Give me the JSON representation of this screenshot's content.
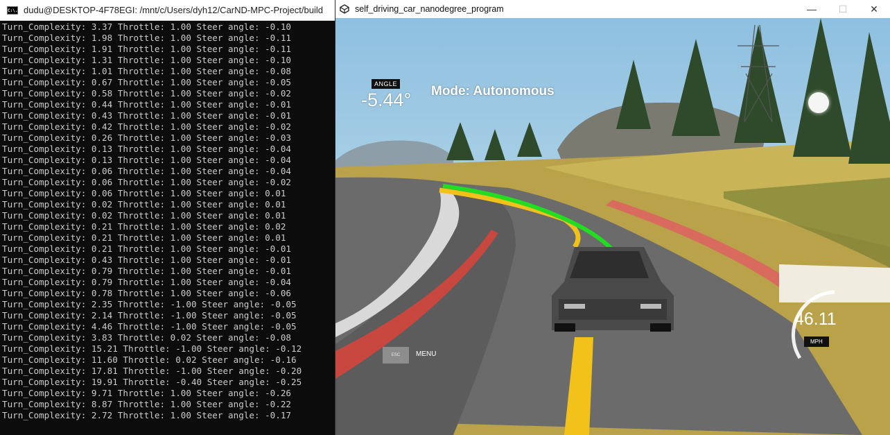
{
  "terminal": {
    "icon_text": "C:\\.",
    "title": "dudu@DESKTOP-4F78EGI: /mnt/c/Users/dyh12/CarND-MPC-Project/build",
    "lines": [
      "Turn_Complexity: 3.37 Throttle: 1.00 Steer angle: -0.10",
      "Turn_Complexity: 1.98 Throttle: 1.00 Steer angle: -0.11",
      "Turn_Complexity: 1.91 Throttle: 1.00 Steer angle: -0.11",
      "Turn_Complexity: 1.31 Throttle: 1.00 Steer angle: -0.10",
      "Turn_Complexity: 1.01 Throttle: 1.00 Steer angle: -0.08",
      "Turn_Complexity: 0.67 Throttle: 1.00 Steer angle: -0.05",
      "Turn_Complexity: 0.58 Throttle: 1.00 Steer angle: -0.02",
      "Turn_Complexity: 0.44 Throttle: 1.00 Steer angle: -0.01",
      "Turn_Complexity: 0.43 Throttle: 1.00 Steer angle: -0.01",
      "Turn_Complexity: 0.42 Throttle: 1.00 Steer angle: -0.02",
      "Turn_Complexity: 0.26 Throttle: 1.00 Steer angle: -0.03",
      "Turn_Complexity: 0.13 Throttle: 1.00 Steer angle: -0.04",
      "Turn_Complexity: 0.13 Throttle: 1.00 Steer angle: -0.04",
      "Turn_Complexity: 0.06 Throttle: 1.00 Steer angle: -0.04",
      "Turn_Complexity: 0.06 Throttle: 1.00 Steer angle: -0.02",
      "Turn_Complexity: 0.06 Throttle: 1.00 Steer angle: 0.01",
      "Turn_Complexity: 0.02 Throttle: 1.00 Steer angle: 0.01",
      "Turn_Complexity: 0.02 Throttle: 1.00 Steer angle: 0.01",
      "Turn_Complexity: 0.21 Throttle: 1.00 Steer angle: 0.02",
      "Turn_Complexity: 0.21 Throttle: 1.00 Steer angle: 0.01",
      "Turn_Complexity: 0.21 Throttle: 1.00 Steer angle: -0.01",
      "Turn_Complexity: 0.43 Throttle: 1.00 Steer angle: -0.01",
      "Turn_Complexity: 0.79 Throttle: 1.00 Steer angle: -0.01",
      "Turn_Complexity: 0.79 Throttle: 1.00 Steer angle: -0.04",
      "Turn_Complexity: 0.78 Throttle: 1.00 Steer angle: -0.06",
      "Turn_Complexity: 2.35 Throttle: -1.00 Steer angle: -0.05",
      "Turn_Complexity: 2.14 Throttle: -1.00 Steer angle: -0.05",
      "Turn_Complexity: 4.46 Throttle: -1.00 Steer angle: -0.05",
      "Turn_Complexity: 3.83 Throttle: 0.02 Steer angle: -0.08",
      "Turn_Complexity: 15.21 Throttle: -1.00 Steer angle: -0.12",
      "Turn_Complexity: 11.60 Throttle: 0.02 Steer angle: -0.16",
      "Turn_Complexity: 17.81 Throttle: -1.00 Steer angle: -0.20",
      "Turn_Complexity: 19.91 Throttle: -0.40 Steer angle: -0.25",
      "Turn_Complexity: 9.71 Throttle: 1.00 Steer angle: -0.26",
      "Turn_Complexity: 8.87 Throttle: 1.00 Steer angle: -0.22",
      "Turn_Complexity: 2.72 Throttle: 1.00 Steer angle: -0.17"
    ]
  },
  "simulator": {
    "title": "self_driving_car_nanodegree_program",
    "app_icon": "unity-icon",
    "controls": {
      "minimize": "—",
      "maximize": "☐",
      "close": "✕"
    },
    "hud": {
      "angle_label": "ANGLE",
      "angle_value": "-5.44°",
      "mode": "Mode: Autonomous",
      "esc_label": "ESC",
      "menu_label": "MENU",
      "speed_value": "46.11",
      "speed_unit": "MPH"
    }
  },
  "colors": {
    "terminal_bg": "#0c0c0c",
    "terminal_text": "#cccccc",
    "trajectory": "#22dd22",
    "lane_line": "#f2c21b"
  }
}
